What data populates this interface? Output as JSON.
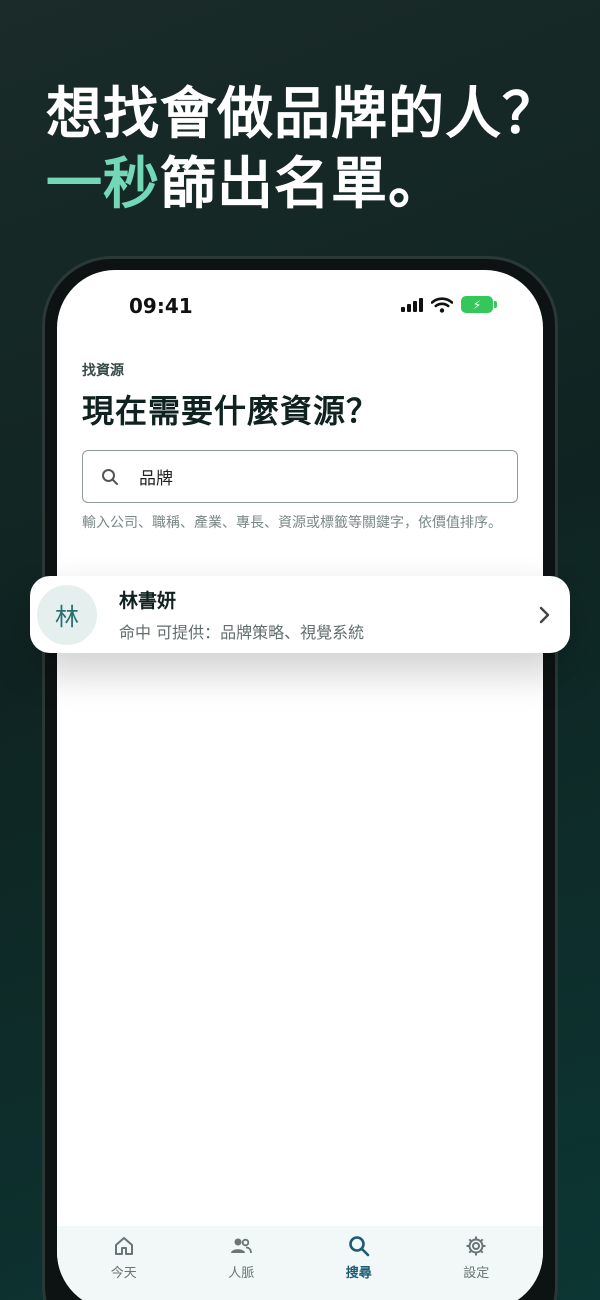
{
  "headline": {
    "line1": "想找會做品牌的人？",
    "line2_accent": "一秒",
    "line2_rest": "篩出名單。"
  },
  "status_bar": {
    "time": "09:41",
    "icons": [
      "signal-icon",
      "wifi-icon",
      "battery-charging-icon"
    ]
  },
  "page": {
    "eyebrow": "找資源",
    "title": "現在需要什麼資源？"
  },
  "search": {
    "value": "品牌",
    "hint": "輸入公司、職稱、產業、專長、資源或標籤等關鍵字，依價值排序。"
  },
  "result": {
    "avatar": "林",
    "name": "林書妍",
    "description": "命中 可提供：品牌策略、視覺系統"
  },
  "tabs": [
    {
      "label": "今天",
      "icon": "home-icon",
      "active": false
    },
    {
      "label": "人脈",
      "icon": "people-icon",
      "active": false
    },
    {
      "label": "搜尋",
      "icon": "search-icon",
      "active": true
    },
    {
      "label": "設定",
      "icon": "gear-icon",
      "active": false
    }
  ],
  "colors": {
    "accent": "#73d8b6",
    "active_tab": "#1b5c74",
    "battery": "#34c759"
  }
}
